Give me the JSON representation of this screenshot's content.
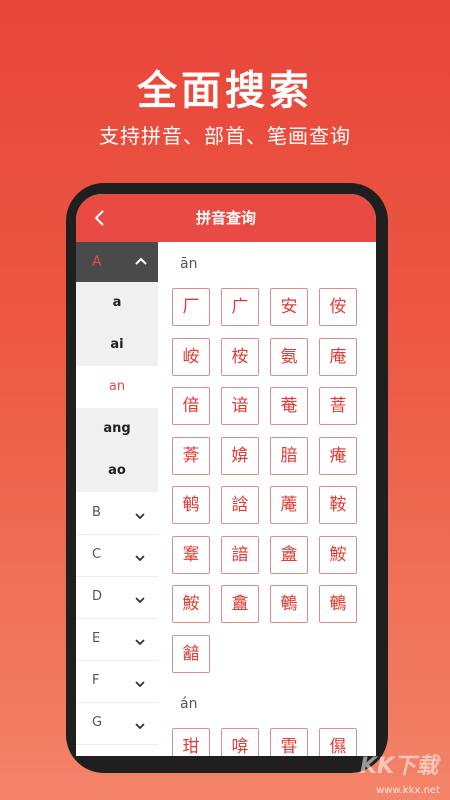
{
  "hero": {
    "title": "全面搜索",
    "subtitle": "支持拼音、部首、笔画查询"
  },
  "app": {
    "title": "拼音查询",
    "back_icon": "chevron-left-icon"
  },
  "sidebar": {
    "open_letter": "A",
    "sub_items": [
      "a",
      "ai",
      "an",
      "ang",
      "ao"
    ],
    "active_sub": "an",
    "letters": [
      "B",
      "C",
      "D",
      "E",
      "F",
      "G"
    ]
  },
  "sections": [
    {
      "label": "ān",
      "chars": [
        "厂",
        "广",
        "安",
        "侒",
        "峖",
        "桉",
        "氨",
        "庵",
        "偣",
        "谙",
        "菴",
        "萻",
        "葊",
        "媕",
        "腤",
        "痷",
        "鹌",
        "誝",
        "蓭",
        "鞍",
        "鞌",
        "諳",
        "盦",
        "鮟",
        "鮟",
        "盫",
        "鵪",
        "鵪",
        "韽"
      ]
    },
    {
      "label": "án",
      "chars": [
        "玵",
        "啽",
        "雸",
        "儑"
      ]
    }
  ],
  "watermark": {
    "text": "KK下载",
    "url": "www.kkx.net"
  },
  "colors": {
    "accent": "#e94a44",
    "char_text": "#e03c35",
    "char_border": "#d8908a"
  }
}
